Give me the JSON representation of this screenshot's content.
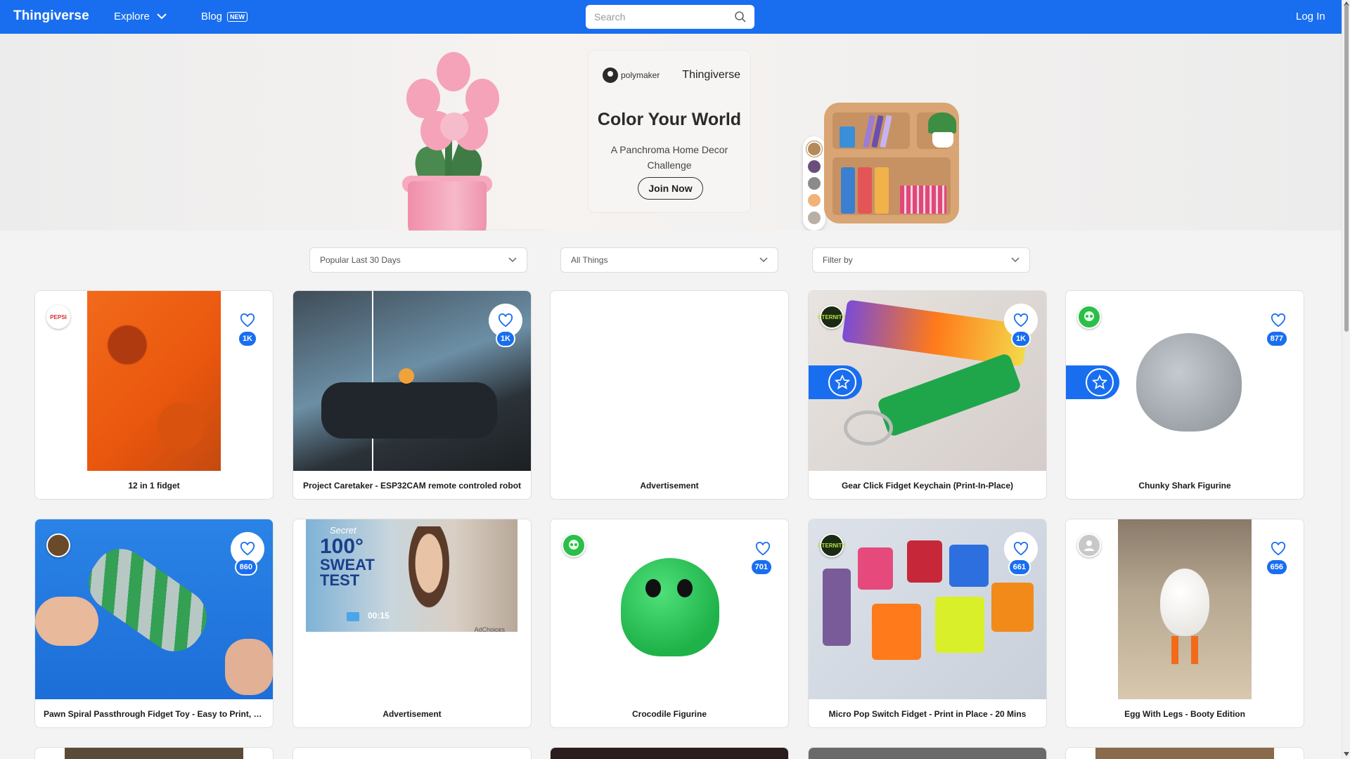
{
  "nav": {
    "logo": "Thingiverse",
    "explore": "Explore",
    "blog": "Blog",
    "blog_badge": "NEW",
    "search_placeholder": "Search",
    "login": "Log In"
  },
  "banner": {
    "sponsor": "polymaker",
    "brand": "Thingiverse",
    "title": "Color Your World",
    "subtitle": "A Panchroma Home Decor Challenge",
    "cta": "Join Now",
    "swatches_horizontal": [
      "#f4a0b6",
      "#f0b87a",
      "#b9d7a6",
      "#8fc4e0",
      "#9a6ec2"
    ],
    "swatches_vertical": [
      "#b48a5a",
      "#6a4f7a",
      "#8a8a8a",
      "#f1b27a",
      "#b8b0a6"
    ]
  },
  "filters": {
    "sort": "Popular Last 30 Days",
    "type": "All Things",
    "filter": "Filter by"
  },
  "colors": {
    "accent": "#196ef0"
  },
  "cards": [
    {
      "title": "12 in 1 fidget",
      "likes": "1K",
      "creator": "PEPSI"
    },
    {
      "title": "Project Caretaker - ESP32CAM remote controled robot",
      "likes": "1K"
    },
    {
      "title": "Advertisement"
    },
    {
      "title": "Gear Click Fidget Keychain (Print-In-Place)",
      "likes": "1K",
      "creator": "ETERNITY"
    },
    {
      "title": "Chunky Shark Figurine",
      "likes": "877"
    },
    {
      "title": "Pawn Spiral Passthrough Fidget Toy - Easy to Print, No ...",
      "likes": "860"
    },
    {
      "title": "Advertisement",
      "ad_line1": "Secret",
      "ad_line2": "100°",
      "ad_line3": "SWEAT",
      "ad_line4": "TEST",
      "ad_time": "00:15",
      "ad_choices": "AdChoices"
    },
    {
      "title": "Crocodile Figurine",
      "likes": "701"
    },
    {
      "title": "Micro Pop Switch Fidget - Print in Place - 20 Mins",
      "likes": "661",
      "creator": "ETERNITY"
    },
    {
      "title": "Egg With Legs - Booty Edition",
      "likes": "656"
    }
  ]
}
